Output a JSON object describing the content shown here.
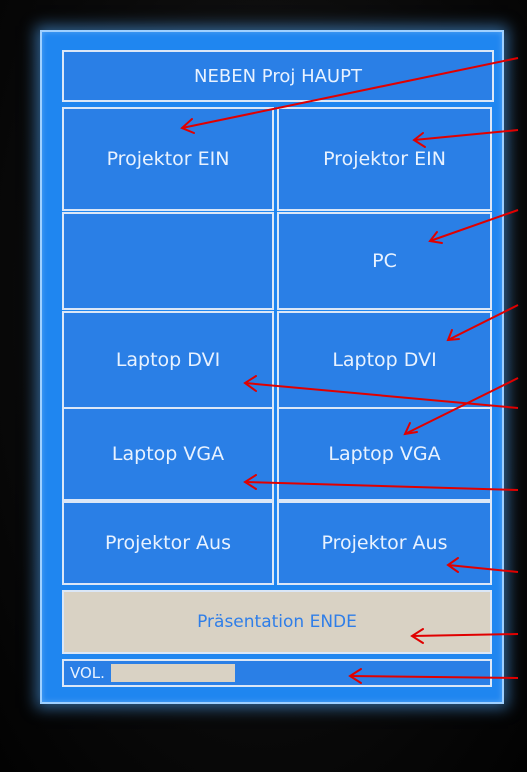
{
  "header": {
    "title": "NEBEN Proj HAUPT"
  },
  "left": {
    "proj_on": "Projektor EIN",
    "blank": "",
    "laptop_dvi": "Laptop DVI",
    "laptop_vga": "Laptop VGA",
    "proj_off": "Projektor Aus"
  },
  "right": {
    "proj_on": "Projektor EIN",
    "pc": "PC",
    "laptop_dvi": "Laptop DVI",
    "laptop_vga": "Laptop VGA",
    "proj_off": "Projektor Aus"
  },
  "footer": {
    "end": "Präsentation ENDE",
    "vol_label": "VOL."
  },
  "colors": {
    "screen": "#1f86f0",
    "tile": "#2a7fe6",
    "tile_border": "#dbe7f7",
    "end_bg": "#d9d2c4",
    "arrow": "#e00000"
  }
}
